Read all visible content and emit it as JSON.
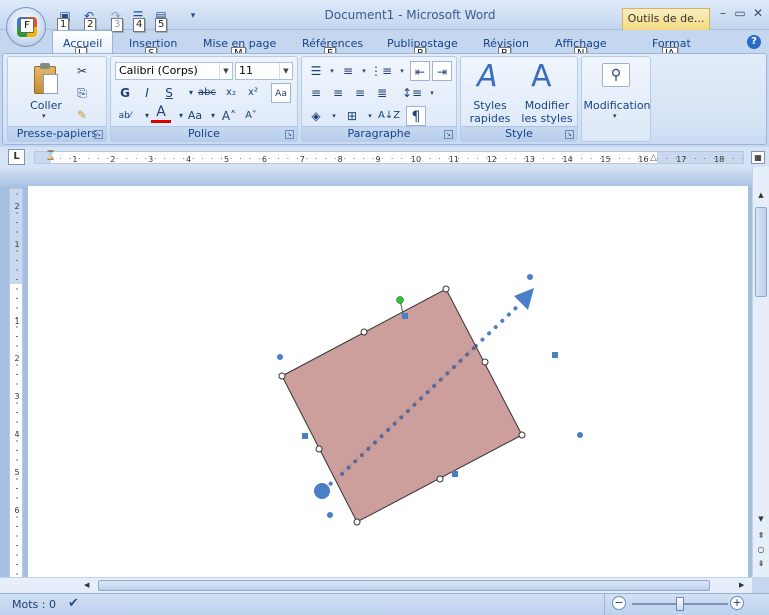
{
  "window": {
    "title": "Document1 - Microsoft Word",
    "context_tab": "Outils de de...",
    "office_keytip": "F"
  },
  "qat": {
    "keytips": [
      "1",
      "2",
      "3",
      "4",
      "5"
    ]
  },
  "tabs": [
    {
      "label": "Accueil",
      "keytip": "L"
    },
    {
      "label": "Insertion",
      "keytip": "S"
    },
    {
      "label": "Mise en page",
      "keytip": "M"
    },
    {
      "label": "Références",
      "keytip": "É"
    },
    {
      "label": "Publipostage",
      "keytip": "P"
    },
    {
      "label": "Révision",
      "keytip": "R"
    },
    {
      "label": "Affichage",
      "keytip": "N"
    },
    {
      "label": "Format",
      "keytip": "JA"
    }
  ],
  "ribbon": {
    "clipboard": {
      "label": "Presse-papiers",
      "paste": "Coller"
    },
    "font": {
      "label": "Police",
      "font_name": "Calibri (Corps)",
      "font_size": "11"
    },
    "paragraph": {
      "label": "Paragraphe"
    },
    "styles": {
      "label": "Style",
      "quick_styles_1": "Styles",
      "quick_styles_2": "rapides",
      "change_styles_1": "Modifier",
      "change_styles_2": "les styles"
    },
    "editing": {
      "label": "Modification"
    }
  },
  "ruler": {
    "h_marks": [
      "1",
      "2",
      "1",
      "2",
      "3",
      "4",
      "5",
      "6",
      "7",
      "8",
      "9",
      "10",
      "11",
      "12",
      "13",
      "14",
      "15",
      "16",
      "17",
      "18"
    ],
    "v_marks": [
      "2",
      "1",
      "1",
      "2",
      "3",
      "4",
      "5",
      "6"
    ]
  },
  "status": {
    "words": "Mots : 0"
  },
  "colors": {
    "shape_fill": "#c99a98",
    "shape_stroke": "#333333",
    "connector": "#4a7fc8",
    "rotate_handle": "#22cc22"
  },
  "zoom": {
    "percent": 100
  }
}
